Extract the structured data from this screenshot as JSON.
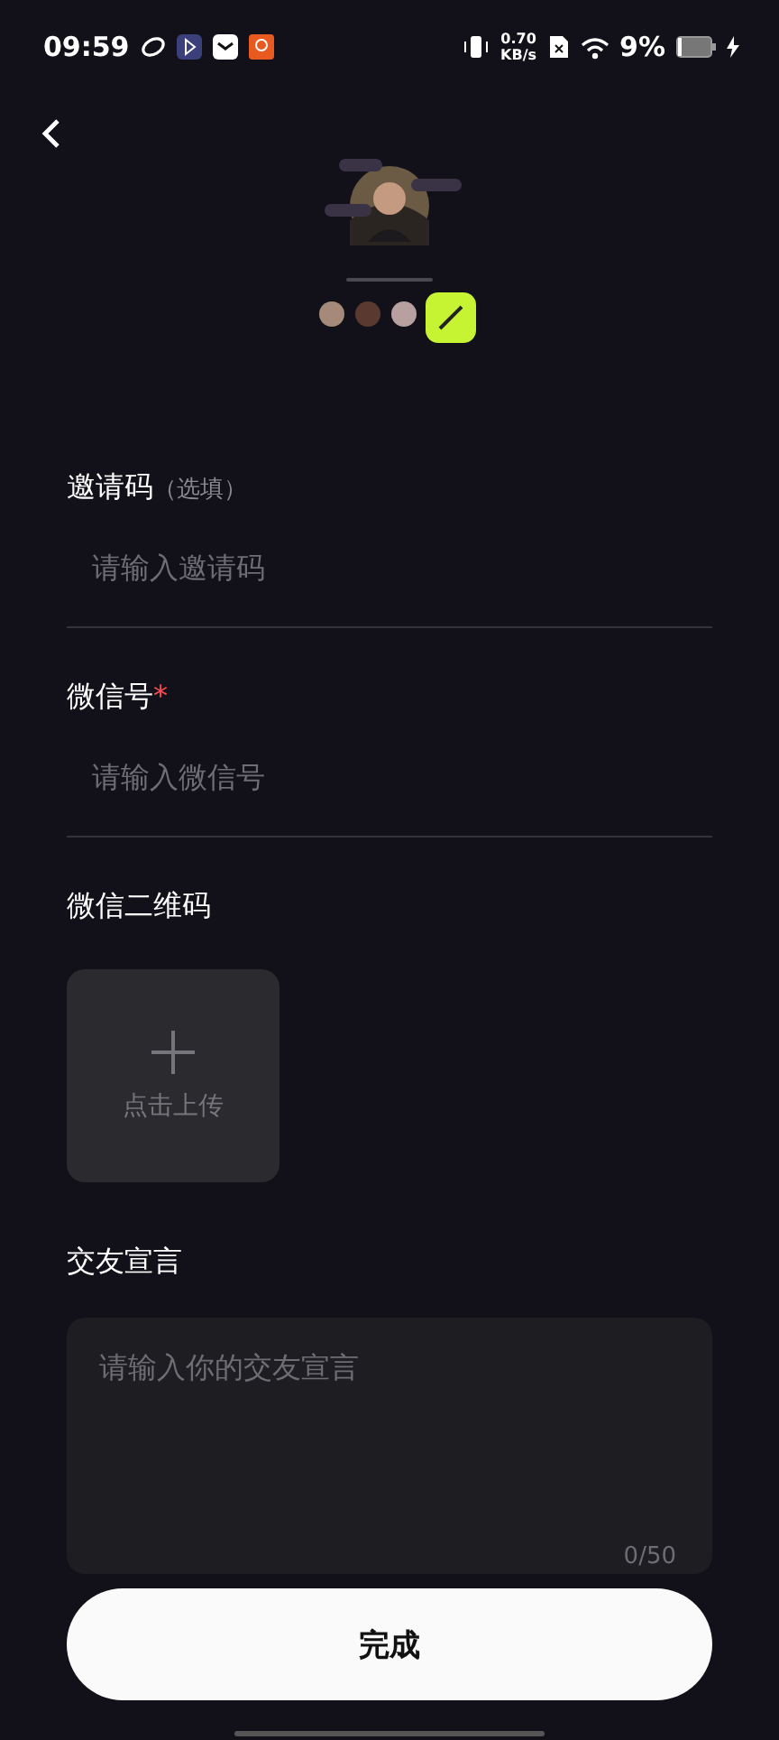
{
  "status_bar": {
    "time": "09:59",
    "speed_value": "0.70",
    "speed_unit": "KB/s",
    "battery": "9%",
    "charging": true
  },
  "fields": [
    {
      "kind": "line",
      "label": "邀请码",
      "hint": "（选填）",
      "placeholder": "请输入邀请码"
    },
    {
      "kind": "line",
      "label": "微信号",
      "required_mark": "*",
      "placeholder": "请输入微信号"
    },
    {
      "kind": "upload",
      "label": "微信二维码",
      "placeholder": "点击上传"
    },
    {
      "kind": "area",
      "label": "交友宣言",
      "placeholder": "请输入你的交友宣言",
      "counter": "0/50"
    }
  ],
  "submit": "完成"
}
